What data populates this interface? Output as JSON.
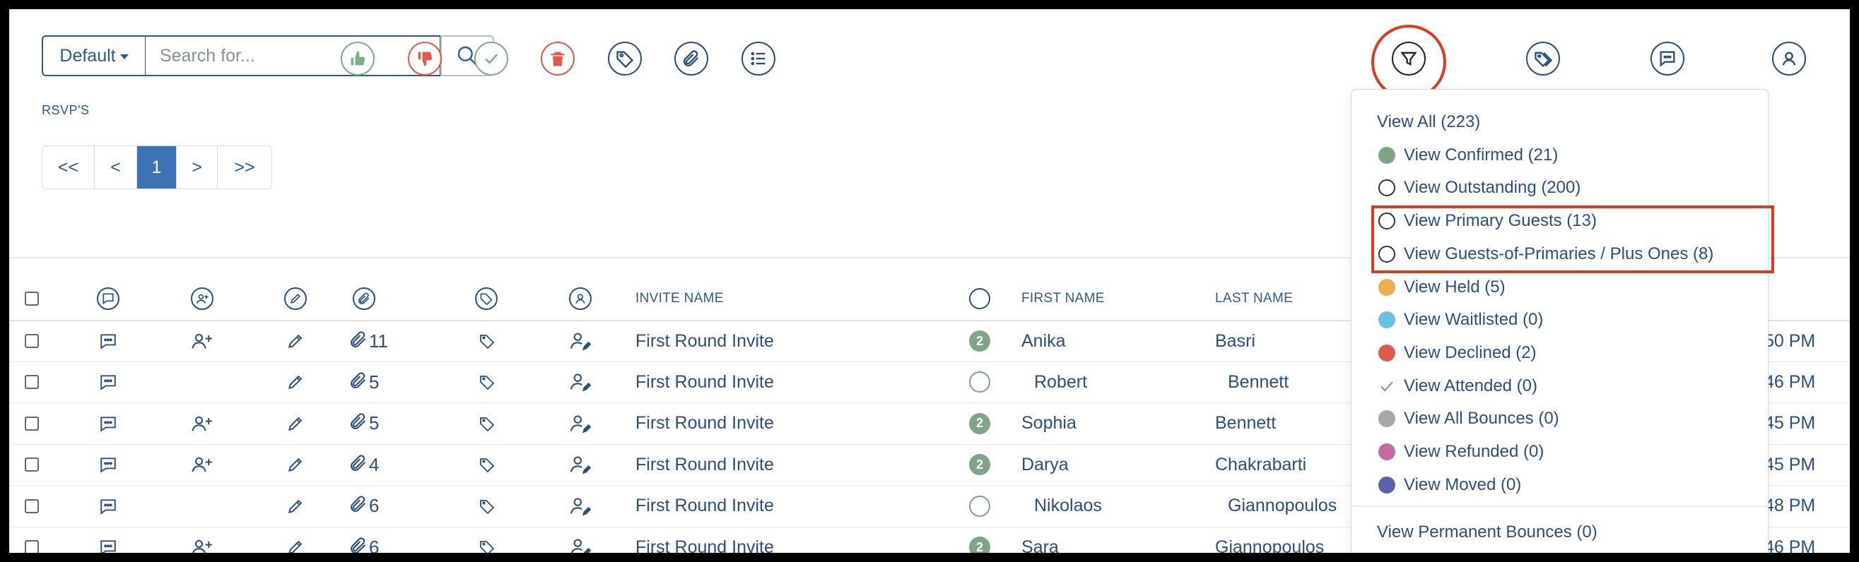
{
  "toolbar": {
    "view_select": "Default",
    "search_placeholder": "Search for...",
    "actions": [
      {
        "name": "confirm-icon",
        "color": "#7fae8b"
      },
      {
        "name": "decline-icon",
        "color": "#e05b4b"
      },
      {
        "name": "check-icon",
        "color": "#7fae8b"
      },
      {
        "name": "trash-icon",
        "color": "#e05b4b"
      },
      {
        "name": "tag-icon",
        "color": "#2a4f80"
      },
      {
        "name": "paperclip-icon",
        "color": "#2a4f80"
      },
      {
        "name": "list-icon",
        "color": "#2a4f80"
      },
      {
        "name": "filter-icon",
        "color": "#222222"
      },
      {
        "name": "tags-icon",
        "color": "#2a4f80"
      },
      {
        "name": "comment-icon",
        "color": "#2a4f80"
      },
      {
        "name": "user-icon",
        "color": "#2a4f80"
      }
    ]
  },
  "section_label": "RSVP'S",
  "pagination": {
    "first": "<<",
    "prev": "<",
    "current": "1",
    "next": ">",
    "last": ">>"
  },
  "table": {
    "headers": {
      "invite_name": "INVITE NAME",
      "first_name": "FIRST NAME",
      "last_name": "LAST NAME"
    },
    "rows": [
      {
        "add_guest": true,
        "attachments": "11",
        "invite": "First Round Invite",
        "status": "2",
        "first": "Anika",
        "last": "Basri",
        "time": ":50 PM"
      },
      {
        "add_guest": false,
        "attachments": "5",
        "invite": "First Round Invite",
        "status": "",
        "first": "Robert",
        "last": "Bennett",
        "time": ":46 PM"
      },
      {
        "add_guest": true,
        "attachments": "5",
        "invite": "First Round Invite",
        "status": "2",
        "first": "Sophia",
        "last": "Bennett",
        "time": ":45 PM"
      },
      {
        "add_guest": true,
        "attachments": "4",
        "invite": "First Round Invite",
        "status": "2",
        "first": "Darya",
        "last": "Chakrabarti",
        "time": ":45 PM"
      },
      {
        "add_guest": false,
        "attachments": "6",
        "invite": "First Round Invite",
        "status": "",
        "first": "Nikolaos",
        "last": "Giannopoulos",
        "time": ":48 PM"
      },
      {
        "add_guest": true,
        "attachments": "6",
        "invite": "First Round Invite",
        "status": "2",
        "first": "Sara",
        "last": "Giannopoulos",
        "time": ":46 PM"
      }
    ]
  },
  "filter_menu": {
    "items": [
      {
        "label": "View All (223)",
        "marker": "none"
      },
      {
        "label": "View Confirmed (21)",
        "marker": "dot",
        "color": "#7fa487"
      },
      {
        "label": "View Outstanding (200)",
        "marker": "hollow"
      },
      {
        "label": "View Primary Guests (13)",
        "marker": "hollow"
      },
      {
        "label": "View Guests-of-Primaries / Plus Ones (8)",
        "marker": "hollow"
      },
      {
        "label": "View Held (5)",
        "marker": "dot",
        "color": "#eab04f"
      },
      {
        "label": "View Waitlisted (0)",
        "marker": "dot",
        "color": "#6ac0e2"
      },
      {
        "label": "View Declined (2)",
        "marker": "dot",
        "color": "#df5a4a"
      },
      {
        "label": "View Attended (0)",
        "marker": "check",
        "color": "#7fa487"
      },
      {
        "label": "View All Bounces (0)",
        "marker": "dot",
        "color": "#a8a8a8"
      },
      {
        "label": "View Refunded (0)",
        "marker": "dot",
        "color": "#c56a9f"
      },
      {
        "label": "View Moved (0)",
        "marker": "dot",
        "color": "#5a63a8"
      }
    ],
    "permanent_bounces": "View Permanent Bounces (0)"
  }
}
